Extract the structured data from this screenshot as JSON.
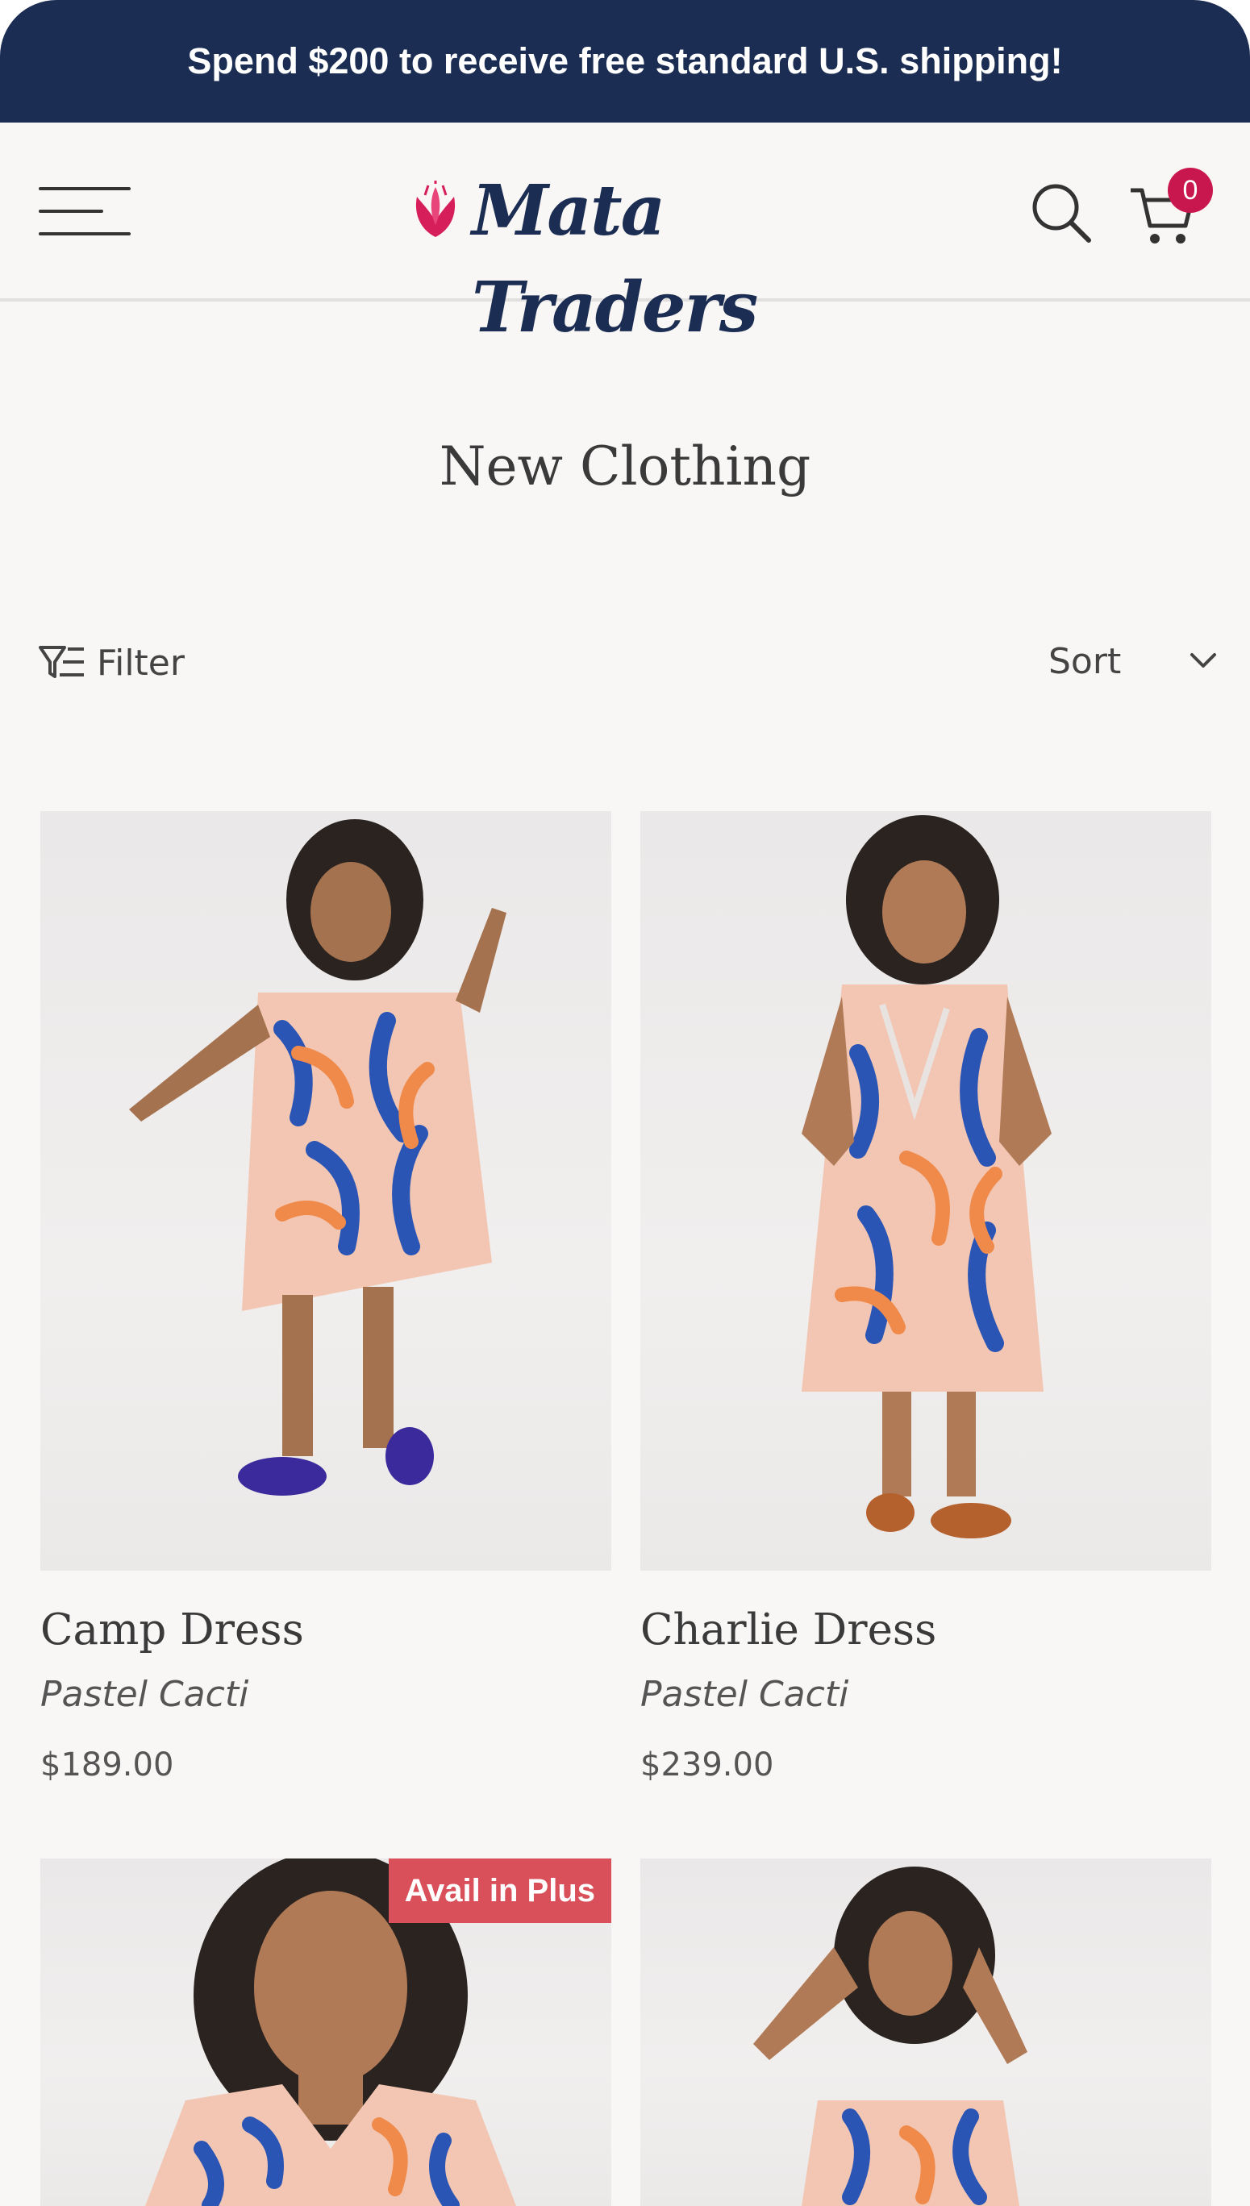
{
  "announcement": "Spend $200 to receive free standard U.S. shipping!",
  "header": {
    "logo_text": "Mata Traders",
    "cart_count": "0"
  },
  "page": {
    "title": "New Clothing"
  },
  "toolbar": {
    "filter_label": "Filter",
    "sort_label": "Sort"
  },
  "products": [
    {
      "name": "Camp Dress",
      "variant": "Pastel Cacti",
      "price": "$189.00",
      "badge": ""
    },
    {
      "name": "Charlie Dress",
      "variant": "Pastel Cacti",
      "price": "$239.00",
      "badge": ""
    },
    {
      "name": "",
      "variant": "",
      "price": "",
      "badge": "Avail in Plus"
    },
    {
      "name": "",
      "variant": "",
      "price": "",
      "badge": ""
    }
  ],
  "colors": {
    "announcement_bg": "#1b2d52",
    "brand_navy": "#1b2d52",
    "brand_pink": "#d61f5a",
    "cart_badge": "#c8174f",
    "plus_badge": "#d9505a",
    "page_bg": "#f9f7f6"
  },
  "icons": {
    "menu": "hamburger-menu-icon",
    "search": "search-icon",
    "cart": "shopping-cart-icon",
    "filter": "filter-icon",
    "sort": "chevron-down-icon",
    "logo_flower": "lotus-flower-icon"
  }
}
